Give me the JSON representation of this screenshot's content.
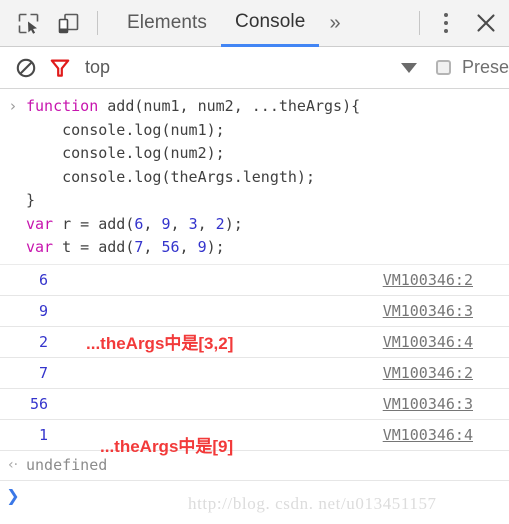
{
  "tabbar": {
    "inspect_icon": "inspect-element-icon",
    "device_icon": "device-toolbar-icon",
    "tabs": [
      {
        "label": "Elements",
        "active": false
      },
      {
        "label": "Console",
        "active": true
      }
    ],
    "more_tabs_label": "»",
    "kebab_icon": "more-options-icon",
    "close_icon": "close-icon"
  },
  "filterbar": {
    "clear_icon": "clear-console-icon",
    "filter_icon": "filter-funnel-icon",
    "context": "top",
    "caret_icon": "chevron-down-icon",
    "preserve_log_label": "Prese",
    "preserve_log_checked": false
  },
  "console": {
    "input_prompt": "›",
    "command_lines": [
      {
        "segments": [
          {
            "t": "function ",
            "c": "kw"
          },
          {
            "t": "add(num1, num2, ...theArgs){",
            "c": ""
          }
        ]
      },
      {
        "segments": [
          {
            "t": "    console.log(num1);",
            "c": ""
          }
        ]
      },
      {
        "segments": [
          {
            "t": "    console.log(num2);",
            "c": ""
          }
        ]
      },
      {
        "segments": [
          {
            "t": "    console.log(theArgs.length);",
            "c": ""
          }
        ]
      },
      {
        "segments": [
          {
            "t": "}",
            "c": ""
          }
        ]
      },
      {
        "segments": [
          {
            "t": "var",
            "c": "kw"
          },
          {
            "t": " r = add(",
            "c": ""
          },
          {
            "t": "6",
            "c": "num"
          },
          {
            "t": ", ",
            "c": ""
          },
          {
            "t": "9",
            "c": "num"
          },
          {
            "t": ", ",
            "c": ""
          },
          {
            "t": "3",
            "c": "num"
          },
          {
            "t": ", ",
            "c": ""
          },
          {
            "t": "2",
            "c": "num"
          },
          {
            "t": ");",
            "c": ""
          }
        ]
      },
      {
        "segments": [
          {
            "t": "var",
            "c": "kw"
          },
          {
            "t": " t = add(",
            "c": ""
          },
          {
            "t": "7",
            "c": "num"
          },
          {
            "t": ", ",
            "c": ""
          },
          {
            "t": "56",
            "c": "num"
          },
          {
            "t": ", ",
            "c": ""
          },
          {
            "t": "9",
            "c": "num"
          },
          {
            "t": ");",
            "c": ""
          }
        ]
      }
    ],
    "log_rows": [
      {
        "value": "6",
        "note": "",
        "note_shifted": false,
        "source": "VM100346:2"
      },
      {
        "value": "9",
        "note": "",
        "note_shifted": false,
        "source": "VM100346:3"
      },
      {
        "value": "2",
        "note": "...theArgs中是[3,2]",
        "note_shifted": false,
        "source": "VM100346:4"
      },
      {
        "value": "7",
        "note": "",
        "note_shifted": false,
        "source": "VM100346:2"
      },
      {
        "value": "56",
        "note": "",
        "note_shifted": false,
        "source": "VM100346:3"
      },
      {
        "value": "1",
        "note": "...theArgs中是[9]",
        "note_shifted": true,
        "source": "VM100346:4"
      }
    ],
    "result": {
      "arrow": "‹·",
      "text": "undefined"
    },
    "prompt": "❯"
  },
  "watermark": "http://blog. csdn. net/u013451157",
  "colors": {
    "accent_tab_underline": "#4285f4",
    "keyword": "#c715ae",
    "number": "#3333cc",
    "annotation_red": "#f23a3a",
    "filter_icon_red": "#e01b1b",
    "link_gray": "#767676"
  }
}
